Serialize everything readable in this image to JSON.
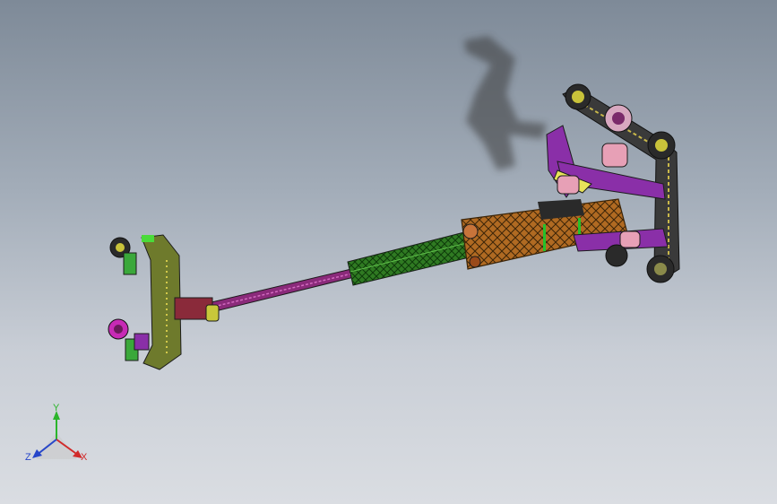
{
  "viewport": {
    "background_top": "#7e8a98",
    "background_bottom": "#dadde2"
  },
  "model": {
    "colors": {
      "orange": "#b06a22",
      "green": "#2f7a22",
      "olive": "#6e7a2c",
      "purple": "#8a2fa8",
      "magenta": "#c72ab5",
      "pink": "#e7a0b6",
      "dark": "#1c1c1c"
    }
  },
  "triad": {
    "y_label": "Y",
    "x_label": "X",
    "z_label": "Z",
    "y_color": "#2bb52b",
    "x_color": "#d12a2a",
    "z_color": "#2746c9"
  }
}
